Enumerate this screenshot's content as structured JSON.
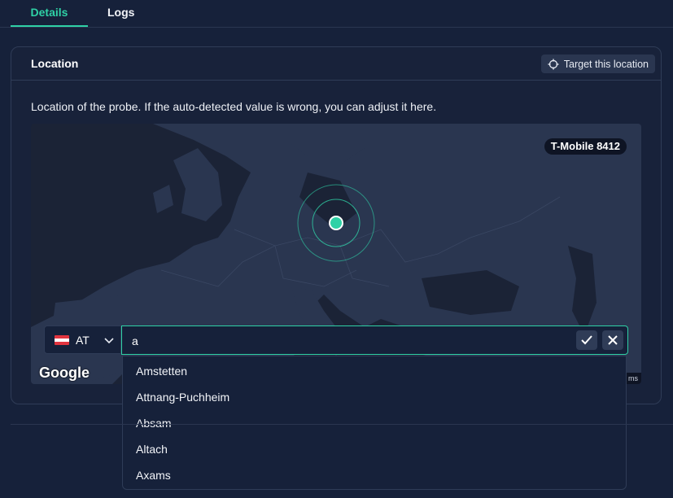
{
  "tabs": [
    {
      "label": "Details",
      "active": true
    },
    {
      "label": "Logs",
      "active": false
    }
  ],
  "card": {
    "title": "Location",
    "target_button": "Target this location",
    "description": "Location of the probe. If the auto-detected value is wrong, you can adjust it here."
  },
  "map": {
    "probe_label": "T-Mobile 8412",
    "attribution": "Google",
    "terms": "ms"
  },
  "location_input": {
    "country_code": "AT",
    "country_flag": "austria-flag-icon",
    "value": "a"
  },
  "suggestions": [
    "Amstetten",
    "Attnang-Puchheim",
    "Absam",
    "Altach",
    "Axams"
  ],
  "colors": {
    "accent": "#2fd1a6",
    "background": "#16213a",
    "land": "#2a3650",
    "water": "#1b2336"
  }
}
